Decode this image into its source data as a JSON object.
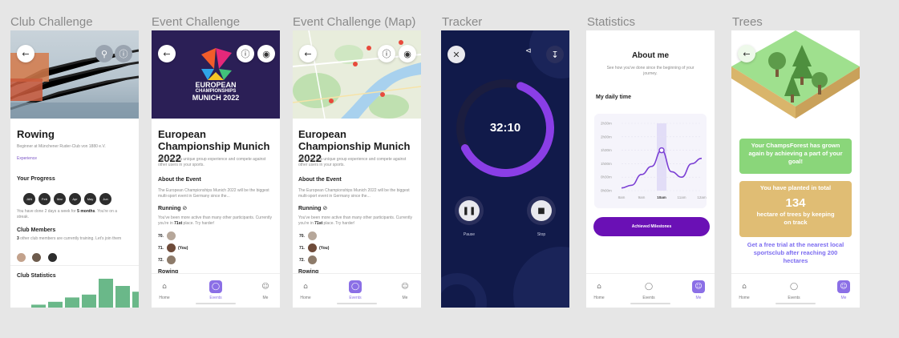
{
  "frames": {
    "club": "Club Challenge",
    "event": "Event Challenge",
    "event_map": "Event Challenge (Map)",
    "tracker": "Tracker",
    "statistics": "Statistics",
    "trees": "Trees"
  },
  "nav": {
    "home": "Home",
    "events": "Events",
    "me": "Me"
  },
  "icons": {
    "back": "back-icon",
    "zoom": "zoom-icon",
    "info": "info-icon",
    "location": "location-icon",
    "close": "close-icon",
    "share": "share-icon",
    "download": "download-icon"
  },
  "club": {
    "title": "Rowing",
    "subtitle": "Beginner at Münchener Ruder-Club von 1880 e.V.",
    "experience_link": "Experience",
    "progress_heading": "Your Progress",
    "months": [
      "JAN",
      "Feb",
      "Mar",
      "Apr",
      "May",
      "Jun"
    ],
    "progress_text_a": "You have done 2 days a week for ",
    "progress_text_b": "5 months",
    "progress_text_c": ". You're on a streak.",
    "members_heading": "Club Members",
    "members_count": "3",
    "members_text": " other club members are currently training. Let's join them",
    "stats_heading": "Club Statistics",
    "stats_bars": [
      2,
      4,
      7,
      9,
      20,
      15,
      11
    ]
  },
  "event": {
    "logo_line1": "EUROPEAN",
    "logo_line2": "CHAMPIONSHIPS",
    "logo_line3": "MUNICH 2022",
    "title": "European Championship Munich 2022",
    "intro": "Take part in a unique group experience and compete against other users in your sports.",
    "about_heading": "About the Event",
    "about_text": "The European Championships Munich 2022 will be the biggest multi-sport event in Germany since the...",
    "running_heading": "Running",
    "running_icon": "check-circle-icon",
    "running_text_a": "You've been more active than many other participants. Currently you're in ",
    "running_place": "71st",
    "running_text_b": " place. Try harder!",
    "ranks": [
      {
        "rank": "70.",
        "you": "",
        "color": "#b6a79a"
      },
      {
        "rank": "71.",
        "you": "(You)",
        "color": "#6e4b3a"
      },
      {
        "rank": "72.",
        "you": "",
        "color": "#8d7b6a"
      }
    ],
    "rowing_heading": "Rowing"
  },
  "map": {
    "title": "European Championship Munich 2022",
    "intro": "Take part in a unique group experience and compete against other users in your sports.",
    "about_heading": "About the Event",
    "about_text": "The European Championships Munich 2022 will be the biggest multi-sport event in Germany since the...",
    "running_heading": "Running",
    "running_text_a": "You've been more active than many other participants. Currently you're in ",
    "running_place": "71st",
    "running_text_b": " place. Try harder!",
    "ranks": [
      {
        "rank": "70.",
        "you": "",
        "color": "#b6a79a"
      },
      {
        "rank": "71.",
        "you": "(You)",
        "color": "#6e4b3a"
      },
      {
        "rank": "72.",
        "you": "",
        "color": "#8d7b6a"
      }
    ],
    "rowing_heading": "Rowing"
  },
  "tracker": {
    "time": "32:10",
    "progress": 0.62,
    "pause_label": "Pause",
    "stop_label": "Stop"
  },
  "statistics": {
    "title": "About me",
    "subtitle": "See how you've done since the beginning of your journey.",
    "daily_heading": "My daily time",
    "milestones_button": "Achieved Milestones"
  },
  "chart_data": {
    "type": "line",
    "title": "My daily time",
    "x": [
      "8am",
      "9am",
      "10am",
      "11am",
      "12am"
    ],
    "yticks": [
      "0h00m",
      "0h30m",
      "1h00m",
      "1h30m",
      "2h00m",
      "2h30m"
    ],
    "points": [
      [
        0,
        0.1
      ],
      [
        0.5,
        0.2
      ],
      [
        1,
        0.6
      ],
      [
        1.5,
        0.9
      ],
      [
        2,
        1.5
      ],
      [
        2.5,
        0.7
      ],
      [
        3,
        0.5
      ],
      [
        3.5,
        1.0
      ],
      [
        4,
        1.2
      ]
    ],
    "highlight_x": "10am",
    "ylim": [
      0,
      2.5
    ]
  },
  "trees": {
    "card1": "Your ChampsForest has grown again by achieving a part of your goal!",
    "card2_top": "You have planted in total",
    "card2_number": "134",
    "card2_bottom": "hectare of trees by keeping on track",
    "trial": "Get a free trial at the nearest local sportsclub after reaching 200 hectares"
  },
  "colors": {
    "purple": "#7c56c6",
    "navy": "#111a4a",
    "green_card": "#8ad67a",
    "gold_card": "#e0bd74",
    "bar_green": "#6ab889"
  }
}
